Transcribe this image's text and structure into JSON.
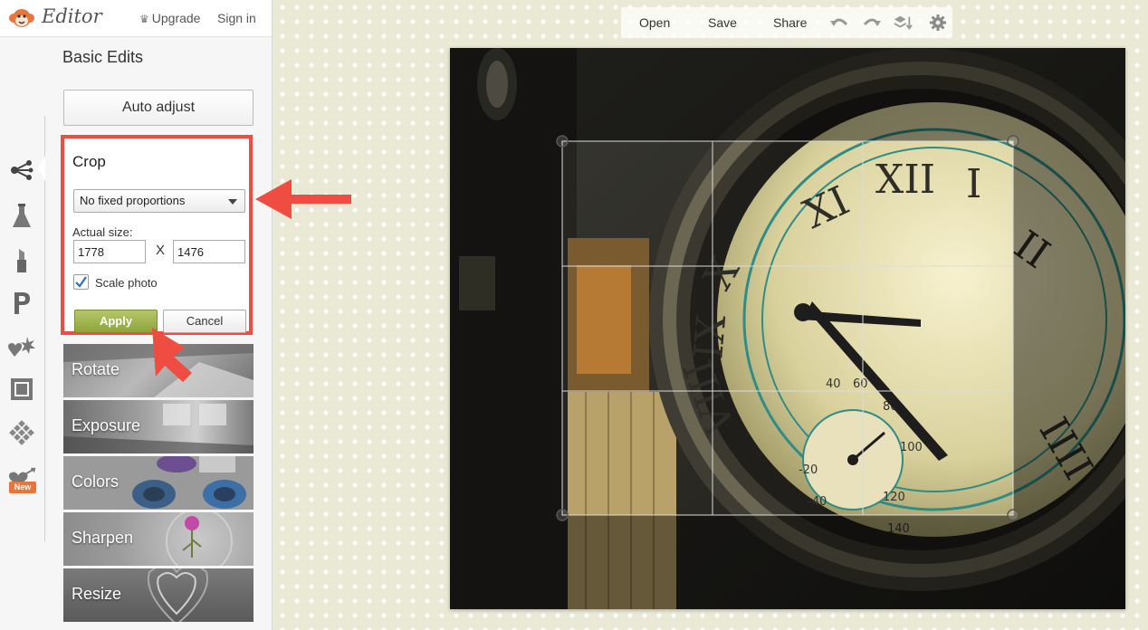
{
  "app": {
    "name": "Editor"
  },
  "header": {
    "upgrade_label": "Upgrade",
    "signin_label": "Sign in"
  },
  "tools": [
    {
      "name": "basic-edits-icon"
    },
    {
      "name": "effects-flask-icon"
    },
    {
      "name": "touch-up-lipstick-icon"
    },
    {
      "name": "text-p-icon"
    },
    {
      "name": "overlays-heart-icon"
    },
    {
      "name": "frames-icon"
    },
    {
      "name": "textures-icon"
    },
    {
      "name": "seasonal-heart-icon",
      "badge": "New"
    }
  ],
  "panel": {
    "title": "Basic Edits",
    "auto_adjust": "Auto adjust",
    "crop": {
      "title": "Crop",
      "proportion": "No fixed proportions",
      "size_label": "Actual size:",
      "width": "1778",
      "height": "1476",
      "x_label": "X",
      "scale_photo": "Scale photo",
      "scale_checked": true,
      "apply": "Apply",
      "cancel": "Cancel"
    },
    "edits": [
      {
        "label": "Rotate"
      },
      {
        "label": "Exposure"
      },
      {
        "label": "Colors"
      },
      {
        "label": "Sharpen"
      },
      {
        "label": "Resize"
      }
    ]
  },
  "toolbar": {
    "open": "Open",
    "save": "Save",
    "share": "Share"
  },
  "colors": {
    "accent_red": "#f04d42",
    "apply_green": "#9cb247",
    "logo_orange": "#e8763c"
  }
}
